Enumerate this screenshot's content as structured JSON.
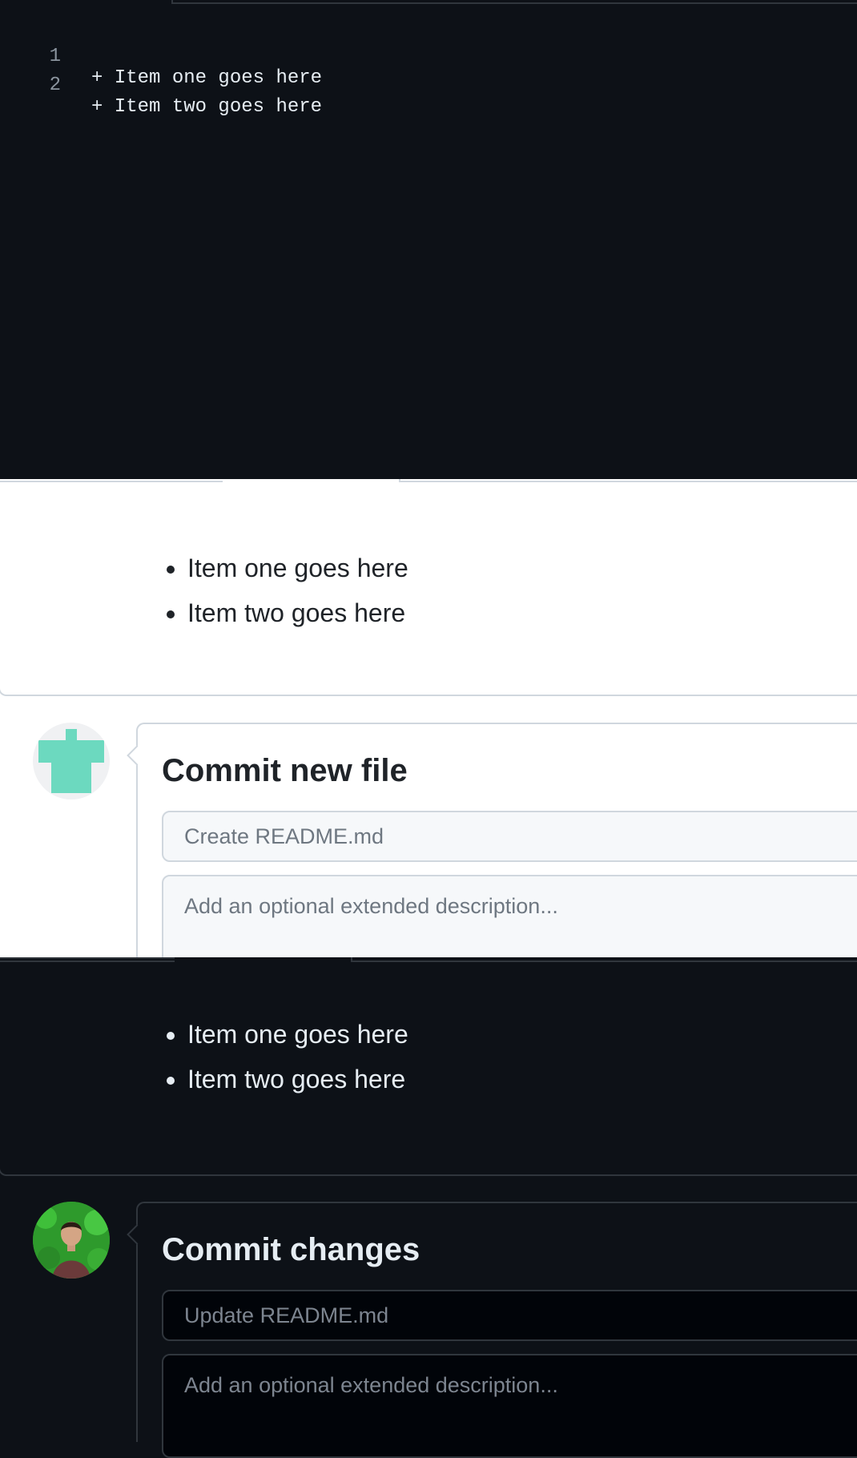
{
  "code_editor": {
    "lines": [
      {
        "number": "1",
        "text": "+ Item one goes here"
      },
      {
        "number": "2",
        "text": "+ Item two goes here"
      }
    ]
  },
  "light_theme": {
    "preview_items": [
      "Item one goes here",
      "Item two goes here"
    ],
    "commit": {
      "title": "Commit new file",
      "summary_placeholder": "Create README.md",
      "description_placeholder": "Add an optional extended description..."
    },
    "avatar_icon": "identicon-avatar"
  },
  "dark_theme": {
    "preview_items": [
      "Item one goes here",
      "Item two goes here"
    ],
    "commit": {
      "title": "Commit changes",
      "summary_placeholder": "Update README.md",
      "description_placeholder": "Add an optional extended description..."
    },
    "avatar_icon": "user-photo-avatar"
  },
  "colors": {
    "dark_bg": "#0d1117",
    "light_bg": "#ffffff",
    "identicon": "#6cd9bf"
  }
}
